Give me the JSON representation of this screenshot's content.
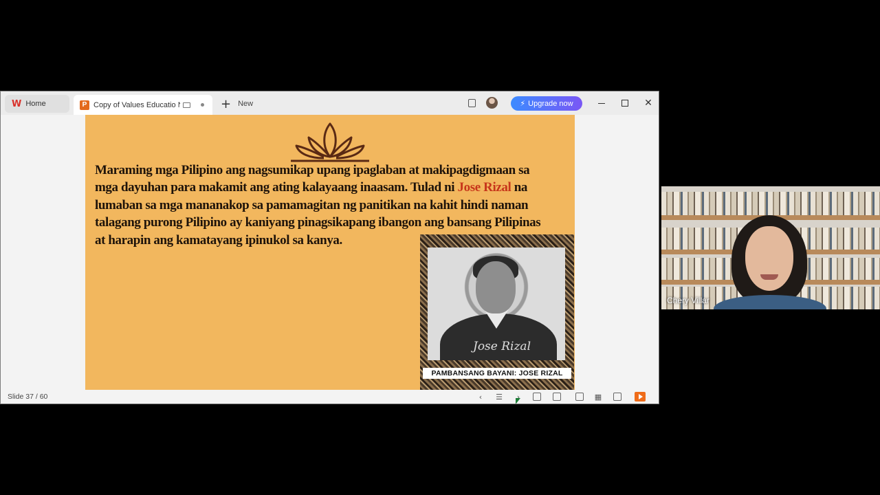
{
  "tabs": {
    "home_label": "Home",
    "doc_label": "Copy of Values Educatio Nat",
    "doc_badge": "P",
    "new_label": "New"
  },
  "toolbar": {
    "upgrade_label": "Upgrade now"
  },
  "slide": {
    "body_1": "Maraming mga Pilipino ang nagsumikap upang ipaglaban at makipagdigmaan sa mga dayuhan para makamit ang ating kalayaang inaasam. Tulad ni ",
    "highlight": "Jose Rizal",
    "body_2": " na lumaban sa mga mananakop sa pamamagitan ng panitikan na kahit hindi naman talagang purong Pilipino ay kaniyang pinagsikapang ibangon ang bansang Pilipinas at harapin ang kamatayang ipinukol sa kanya.",
    "caption": "PAMBANSANG BAYANI: JOSE RIZAL",
    "signature": "Jose Rizal",
    "accent_color": "#c7361b",
    "background_color": "#f2b75e"
  },
  "status": {
    "slide_counter": "Slide 37 / 60"
  },
  "video": {
    "participant_name": "Chery Villar"
  },
  "icons": [
    "wps-logo-icon",
    "monitor-icon",
    "plus-icon",
    "copy-icon",
    "avatar-icon",
    "lightning-icon",
    "lotus-icon",
    "slideshow-icon"
  ]
}
